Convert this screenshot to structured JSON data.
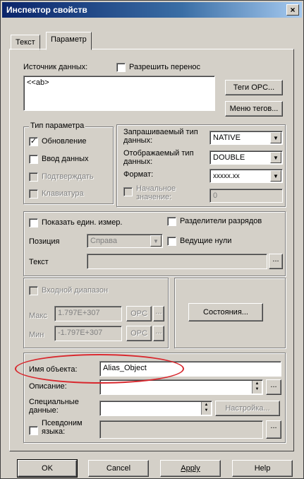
{
  "window": {
    "title": "Инспектор свойств",
    "close_label": "×"
  },
  "tabs": [
    {
      "label": "Текст"
    },
    {
      "label": "Параметр"
    }
  ],
  "source": {
    "label": "Источник данных:",
    "wrap_label": "Разрешить перенос",
    "value": "<<ab>",
    "opc_tags_button": "Теги OPC...",
    "tag_menu_button": "Меню тегов..."
  },
  "param_type": {
    "legend": "Тип параметра",
    "items": [
      {
        "label": "Обновление",
        "checked": "✓"
      },
      {
        "label": "Ввод данных",
        "checked": ""
      },
      {
        "label": "Подтверждать",
        "checked": ""
      },
      {
        "label": "Клавиатура",
        "checked": ""
      }
    ]
  },
  "types": {
    "requested_label": "Запрашиваемый тип данных:",
    "requested_value": "NATIVE",
    "displayed_label": "Отображаемый тип данных:",
    "displayed_value": "DOUBLE",
    "format_label": "Формат:",
    "format_value": "xxxxx.xx",
    "initial_label": "Начальное значение:",
    "initial_value": "0"
  },
  "units": {
    "show_units_label": "Показать един. измер.",
    "separators_label": "Разделители разрядов",
    "position_label": "Позиция",
    "position_value": "Справа",
    "leading_zeros_label": "Ведущие нули",
    "text_label": "Текст",
    "ellipsis": "..."
  },
  "range": {
    "legend": "Входной диапазон",
    "max_label": "Макс",
    "max_value": "1.797E+307",
    "min_label": "Мин",
    "min_value": "-1.797E+307",
    "opc_label": "OPC",
    "ellipsis": "..."
  },
  "states_button": "Состояния...",
  "object": {
    "name_label": "Имя объекта:",
    "name_value": "Alias_Object",
    "description_label": "Описание:",
    "special_label": "Специальные данные:",
    "settings_button": "Настройка...",
    "alias_label": "Псевдоним языка:",
    "ellipsis": "..."
  },
  "footer": {
    "ok": "OK",
    "cancel": "Cancel",
    "apply": "Apply",
    "help": "Help"
  },
  "colors": {
    "highlight": "#d8282e",
    "titlebar": "#0a246a"
  }
}
